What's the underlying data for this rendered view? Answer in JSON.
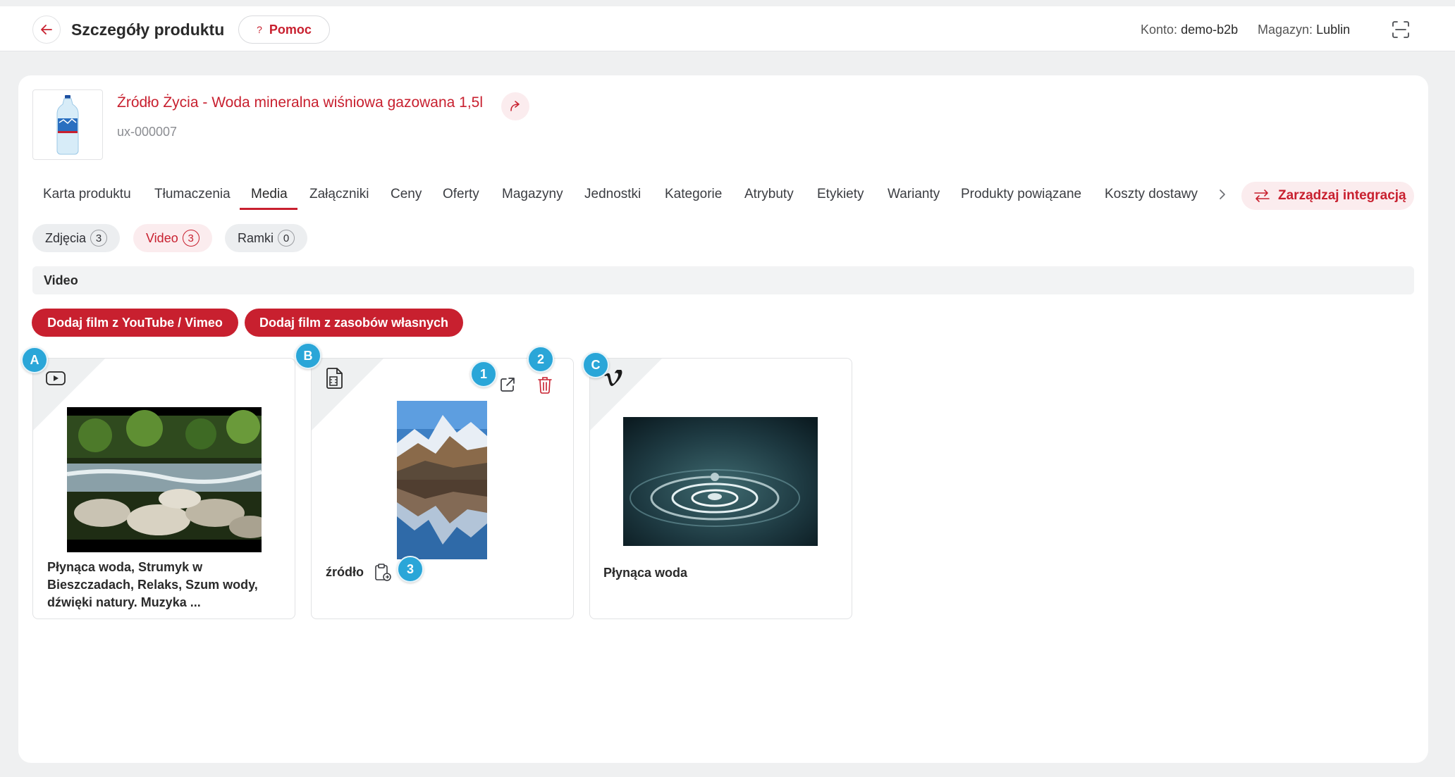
{
  "header": {
    "title": "Szczegóły produktu",
    "help_label": "Pomoc",
    "help_glyph": "?",
    "account_label": "Konto:",
    "account_value": "demo-b2b",
    "warehouse_label": "Magazyn:",
    "warehouse_value": "Lublin"
  },
  "product": {
    "name": "Źródło Życia - Woda mineralna wiśniowa gazowana 1,5l",
    "code": "ux-000007"
  },
  "tabs": [
    {
      "label": "Karta produktu"
    },
    {
      "label": "Tłumaczenia"
    },
    {
      "label": "Media"
    },
    {
      "label": "Załączniki"
    },
    {
      "label": "Ceny"
    },
    {
      "label": "Oferty"
    },
    {
      "label": "Magazyny"
    },
    {
      "label": "Jednostki"
    },
    {
      "label": "Kategorie"
    },
    {
      "label": "Atrybuty"
    },
    {
      "label": "Etykiety"
    },
    {
      "label": "Warianty"
    },
    {
      "label": "Produkty powiązane"
    },
    {
      "label": "Koszty dostawy"
    }
  ],
  "active_tab": "Media",
  "integration_button": "Zarządzaj integracją",
  "media_filters": [
    {
      "label": "Zdjęcia",
      "count": "3"
    },
    {
      "label": "Video",
      "count": "3"
    },
    {
      "label": "Ramki",
      "count": "0"
    }
  ],
  "section_title": "Video",
  "actions": {
    "add_youtube": "Dodaj film z YouTube / Vimeo",
    "add_own": "Dodaj film z zasobów własnych"
  },
  "videos": [
    {
      "source_icon": "youtube-icon",
      "title": "Płynąca woda, Strumyk w Bieszczadach, Relaks, Szum wody, dźwięki natury. Muzyka ..."
    },
    {
      "source_icon": "video-file-icon",
      "title": "źródło"
    },
    {
      "source_icon": "vimeo-icon",
      "title": "Płynąca woda"
    }
  ],
  "badges": {
    "a": "A",
    "b": "B",
    "c": "C",
    "one": "1",
    "two": "2",
    "three": "3"
  },
  "colors": {
    "accent": "#c8202f",
    "accent_light": "#fbecee",
    "badge": "#2aa6d8"
  }
}
